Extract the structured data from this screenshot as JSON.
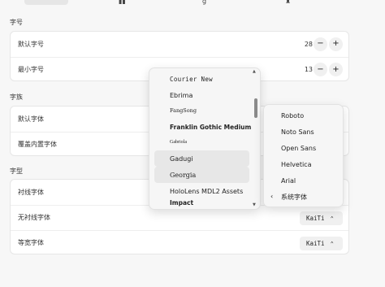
{
  "top": {
    "tab_label": "字体",
    "partial_glyphs": [
      "▮▮",
      "g",
      "♜"
    ]
  },
  "sections": {
    "size": {
      "title": "字号",
      "default_label": "默认字号",
      "default_value": "28",
      "min_label": "最小字号",
      "min_value": "13",
      "minus": "−",
      "plus": "+"
    },
    "family": {
      "title": "字族",
      "default_label": "默认字体",
      "override_label": "覆盖内置字体"
    },
    "type": {
      "title": "字型",
      "serif_label": "衬线字体",
      "sans_label": "无衬线字体",
      "sans_value": "KaiTi",
      "mono_label": "等宽字体",
      "mono_value": "KaiTi",
      "chevron": "⌃"
    }
  },
  "font_list": {
    "items": [
      "Courier New",
      "Ebrima",
      "FangSong",
      "Franklin Gothic Medium",
      "Gabriola",
      "Gadugi",
      "Georgia",
      "HoloLens MDL2 Assets",
      "Impact"
    ],
    "highlighted": [
      "Gadugi",
      "Georgia"
    ],
    "scroll_up": "▲",
    "scroll_down": "▼"
  },
  "submenu": {
    "items": [
      "Roboto",
      "Noto Sans",
      "Open Sans",
      "Helvetica",
      "Arial"
    ],
    "back_icon": "‹",
    "back_label": "系统字体"
  }
}
